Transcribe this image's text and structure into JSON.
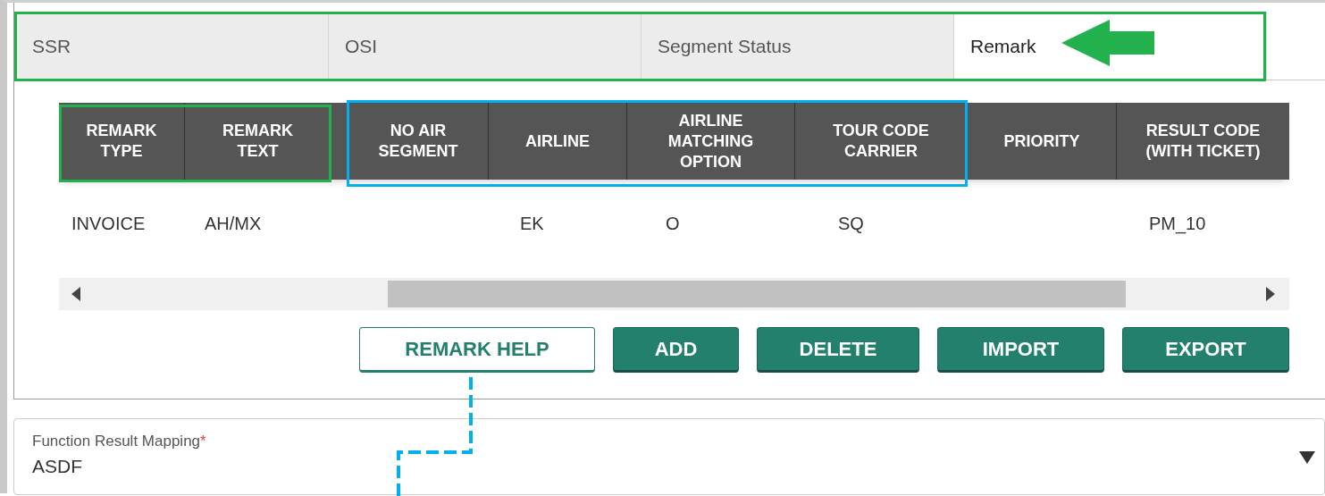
{
  "tabs": [
    {
      "label": "SSR",
      "selected": false
    },
    {
      "label": "OSI",
      "selected": false
    },
    {
      "label": "Segment Status",
      "selected": false
    },
    {
      "label": "Remark",
      "selected": true
    }
  ],
  "table": {
    "columns": [
      "REMARK TYPE",
      "REMARK TEXT",
      "NO AIR SEGMENT",
      "AIRLINE",
      "AIRLINE MATCHING OPTION",
      "TOUR CODE CARRIER",
      "PRIORITY",
      "RESULT CODE (WITH TICKET)"
    ],
    "rows": [
      [
        "INVOICE",
        "AH/MX",
        "",
        "EK",
        "O",
        "SQ",
        "",
        "PM_10"
      ]
    ]
  },
  "buttons": [
    {
      "label": "REMARK HELP",
      "kind": "outline"
    },
    {
      "label": "ADD",
      "kind": "filled"
    },
    {
      "label": "DELETE",
      "kind": "filled"
    },
    {
      "label": "IMPORT",
      "kind": "filled"
    },
    {
      "label": "EXPORT",
      "kind": "filled"
    }
  ],
  "field": {
    "label": "Function Result Mapping",
    "required_mark": "*",
    "value": "ASDF"
  }
}
